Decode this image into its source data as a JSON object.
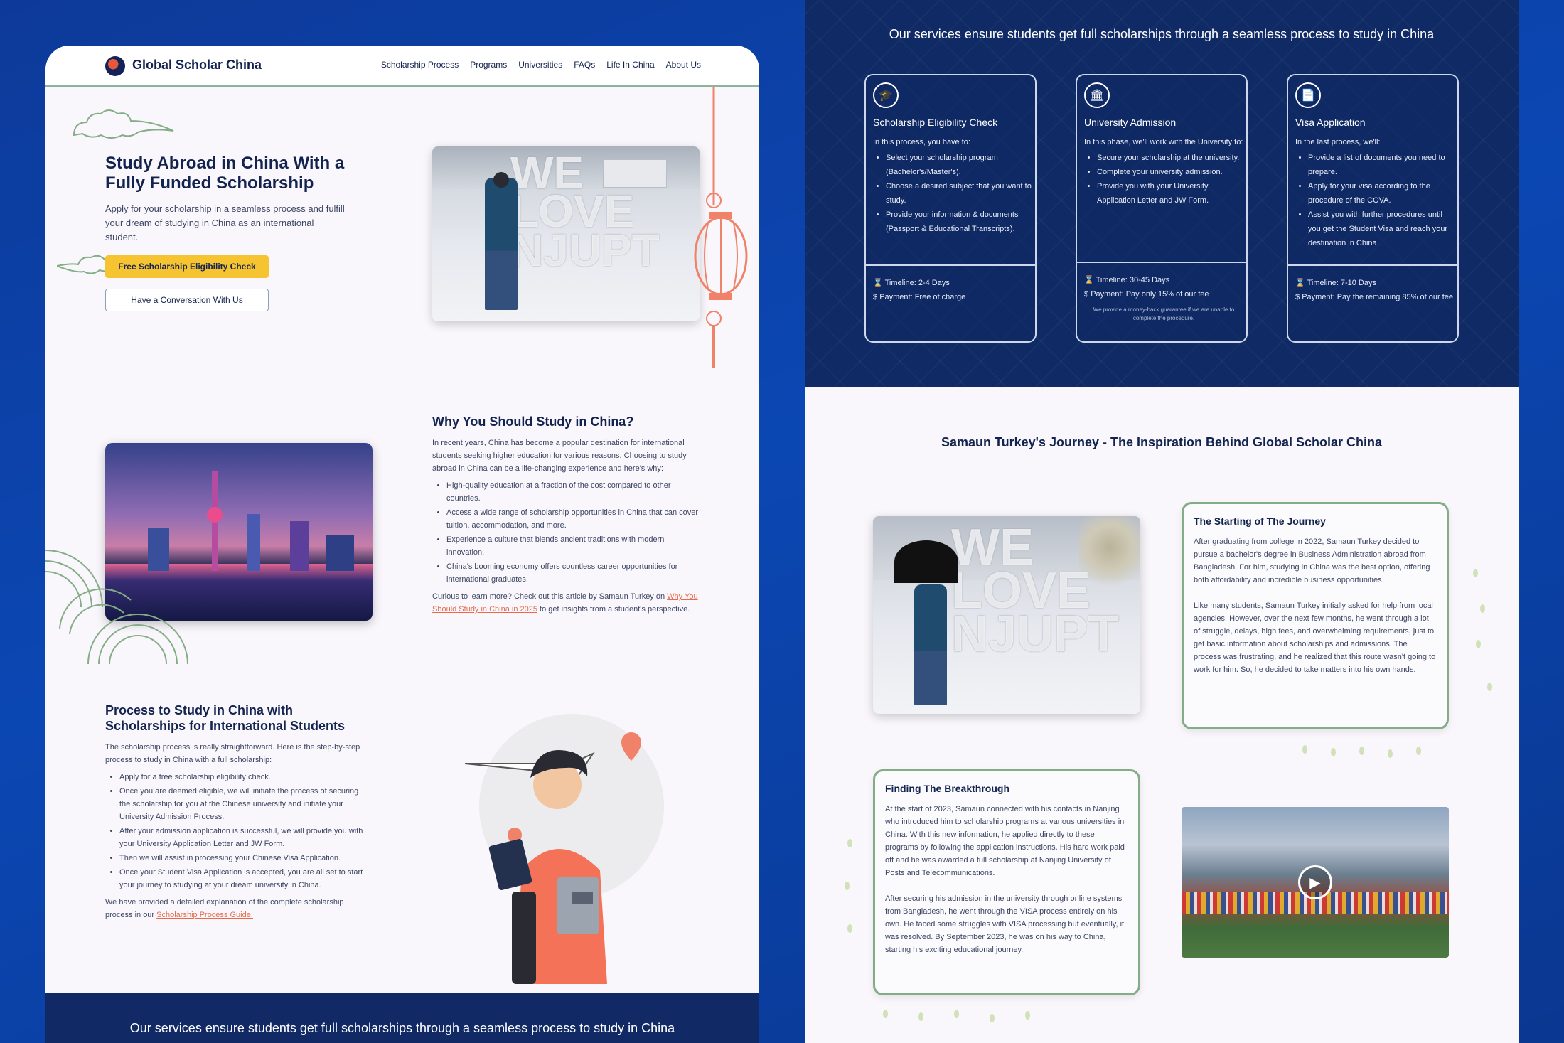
{
  "left": {
    "brand": "Global Scholar China",
    "nav": [
      "Scholarship Process",
      "Programs",
      "Universities",
      "FAQs",
      "Life In China",
      "About Us"
    ],
    "hero": {
      "title": "Study Abroad in China With a Fully Funded Scholarship",
      "lead": "Apply for your scholarship in a seamless process and fulfill your dream of studying in China as an international student.",
      "primary_button": "Free Scholarship Eligibility Check",
      "secondary_button": "Have a Conversation With Us",
      "photo_text": "WE LOVE NJUPT"
    },
    "why": {
      "title": "Why You Should Study in China?",
      "intro": "In recent years, China has become a popular destination for international students seeking higher education for various reasons. Choosing to study abroad in China can be a life-changing experience and here's why:",
      "bullets": [
        "High-quality education at a fraction of the cost compared to other countries.",
        "Access a wide range of scholarship opportunities in China that can cover tuition, accommodation, and more.",
        "Experience a culture that blends ancient traditions with modern innovation.",
        "China's booming economy offers countless career opportunities for international graduates."
      ],
      "outro_prefix": "Curious to learn more? Check out this article by Samaun Turkey on ",
      "outro_link": "Why You Should Study in China in 2025",
      "outro_suffix": " to get insights from a student's perspective."
    },
    "process": {
      "title": "Process to Study in China with Scholarships for International Students",
      "intro": "The scholarship process is really straightforward. Here is the step-by-step process to study in China with a full scholarship:",
      "bullets": [
        "Apply for a free scholarship eligibility check.",
        "Once you are deemed eligible, we will initiate the process of securing the scholarship for you at the Chinese university and initiate your University Admission Process.",
        "After your admission application is successful, we will provide you with your University Application Letter and JW Form.",
        "Then we will assist in processing your Chinese Visa Application.",
        "Once your Student Visa Application is accepted, you are all set to start your journey to studying at your dream university in China."
      ],
      "outro_prefix": "We have provided a detailed explanation of the complete scholarship process in our ",
      "outro_link": "Scholarship Process Guide."
    },
    "banner": "Our services ensure students get full scholarships through a seamless process to study in China"
  },
  "right": {
    "banner": "Our services ensure students get full scholarships through a seamless process to study in China",
    "cards": [
      {
        "icon": "graduation-cap-icon",
        "glyph": "🎓",
        "title": "Scholarship Eligibility Check",
        "intro": "In this process, you have to:",
        "bullets": [
          "Select your scholarship program (Bachelor's/Master's).",
          "Choose a desired subject that you want to study.",
          "Provide your information & documents (Passport & Educational Transcripts)."
        ],
        "timeline": "Timeline: 2-4 Days",
        "payment": "Payment: Free of charge",
        "note": ""
      },
      {
        "icon": "university-icon",
        "glyph": "🏛",
        "title": "University Admission",
        "intro": "In this phase, we'll work with the University to:",
        "bullets": [
          "Secure your scholarship at the university.",
          "Complete your university admission.",
          "Provide you with your University Application Letter and JW Form."
        ],
        "timeline": "Timeline: 30-45 Days",
        "payment": "Payment: Pay only 15% of our fee",
        "note": "We provide a money-back guarantee if we are unable to complete the procedure."
      },
      {
        "icon": "documents-icon",
        "glyph": "📄",
        "title": "Visa Application",
        "intro": "In the last process, we'll:",
        "bullets": [
          "Provide a list of documents you need to prepare.",
          "Apply for your visa according to the procedure of the COVA.",
          "Assist you with further procedures until you get the Student Visa and reach your destination in China."
        ],
        "timeline": "Timeline: 7-10 Days",
        "payment": "Payment: Pay the remaining 85% of our fee",
        "note": ""
      }
    ],
    "journey_title": "Samaun Turkey's Journey - The Inspiration Behind Global Scholar China",
    "start": {
      "title": "The Starting of The Journey",
      "p1": "After graduating from college in 2022, Samaun Turkey decided to pursue a bachelor's degree in Business Administration abroad from Bangladesh. For him, studying in China was the best option, offering both affordability and incredible business opportunities.",
      "p2": "Like many students, Samaun Turkey initially asked for help from local agencies. However, over the next few months, he went through a lot of struggle, delays, high fees, and overwhelming requirements, just to get basic information about scholarships and admissions. The process was frustrating, and he realized that this route wasn't going to work for him. So, he decided to take matters into his own hands."
    },
    "breakthrough": {
      "title": "Finding The Breakthrough",
      "p1": "At the start of 2023, Samaun connected with his contacts in Nanjing who introduced him to scholarship programs at various universities in China. With this new information, he applied directly to these programs by following the application instructions. His hard work paid off and he was awarded a full scholarship at Nanjing University of Posts and Telecommunications.",
      "p2": "After securing his admission in the university through online systems from Bangladesh, he went through the VISA process entirely on his own. He faced some struggles with VISA processing but eventually, it was resolved. By September 2023, he was on his way to China, starting his exciting educational journey."
    },
    "photo_text": "WE LOVE NJUPT"
  },
  "colors": {
    "navy": "#13234f",
    "accent_yellow": "#f7c431",
    "accent_coral": "#e96a4a",
    "green": "#84ad87",
    "bg_blue": "#0b47b3"
  }
}
